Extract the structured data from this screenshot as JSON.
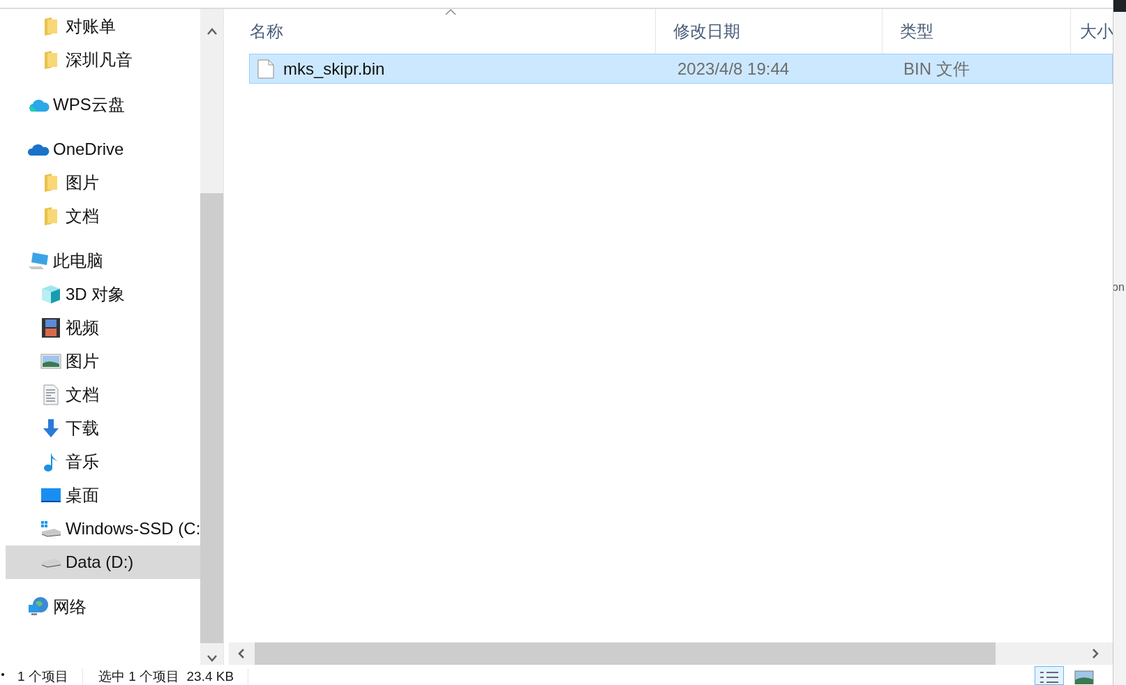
{
  "sidebar": {
    "scrolled_children": [
      {
        "label": "对账单",
        "kind": "folder",
        "selected": false
      },
      {
        "label": "深圳凡音",
        "kind": "folder",
        "selected": false
      }
    ],
    "sections": [
      {
        "label": "WPS云盘",
        "kind": "cloud",
        "selected": false
      },
      {
        "label": "OneDrive",
        "kind": "onedrive",
        "selected": false,
        "children": [
          {
            "label": "图片",
            "kind": "folder",
            "selected": false
          },
          {
            "label": "文档",
            "kind": "folder",
            "selected": false
          }
        ]
      },
      {
        "label": "此电脑",
        "kind": "pc",
        "selected": false,
        "children": [
          {
            "label": "3D 对象",
            "kind": "cube",
            "selected": false
          },
          {
            "label": "视频",
            "kind": "video",
            "selected": false
          },
          {
            "label": "图片",
            "kind": "pictures",
            "selected": false
          },
          {
            "label": "文档",
            "kind": "docs",
            "selected": false
          },
          {
            "label": "下载",
            "kind": "download",
            "selected": false
          },
          {
            "label": "音乐",
            "kind": "music",
            "selected": false
          },
          {
            "label": "桌面",
            "kind": "desktop",
            "selected": false
          },
          {
            "label": "Windows-SSD (C:",
            "kind": "windrive",
            "selected": false
          },
          {
            "label": "Data (D:)",
            "kind": "drive",
            "selected": true
          }
        ]
      },
      {
        "label": "网络",
        "kind": "network",
        "selected": false
      }
    ]
  },
  "file_list": {
    "columns": [
      "名称",
      "修改日期",
      "类型",
      "大小"
    ],
    "rows": [
      {
        "name": "mks_skipr.bin",
        "modified": "2023/4/8 19:44",
        "type": "BIN 文件",
        "selected": true
      }
    ]
  },
  "status_bar": {
    "item_count": "1 个项目",
    "selection": "选中 1 个项目  23.4 KB"
  },
  "view_buttons": [
    {
      "kind": "details",
      "selected": true
    },
    {
      "kind": "tiles",
      "selected": false
    }
  ],
  "side_window_text": "on"
}
